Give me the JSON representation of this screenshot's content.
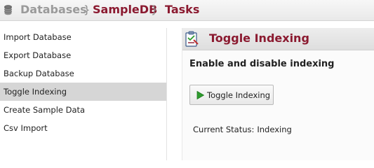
{
  "breadcrumb": {
    "databases": "Databases",
    "separator": "}",
    "database": "SampleDB",
    "current": "Tasks"
  },
  "sidebar": {
    "items": [
      {
        "label": "Import Database"
      },
      {
        "label": "Export Database"
      },
      {
        "label": "Backup Database"
      },
      {
        "label": "Toggle Indexing",
        "active": true
      },
      {
        "label": "Create Sample Data"
      },
      {
        "label": "Csv Import"
      }
    ]
  },
  "panel": {
    "title": "Toggle Indexing",
    "subheading": "Enable and disable indexing",
    "button_label": "Toggle Indexing",
    "status_label": "Current Status:",
    "status_value": "Indexing"
  },
  "colors": {
    "accent": "#8b1a30",
    "muted": "#9a9a9a",
    "active_row": "#d6d6d6",
    "play_green": "#2e9b2e"
  },
  "icons": {
    "breadcrumb": "database-icon",
    "panel": "task-icon",
    "button": "play-icon"
  }
}
